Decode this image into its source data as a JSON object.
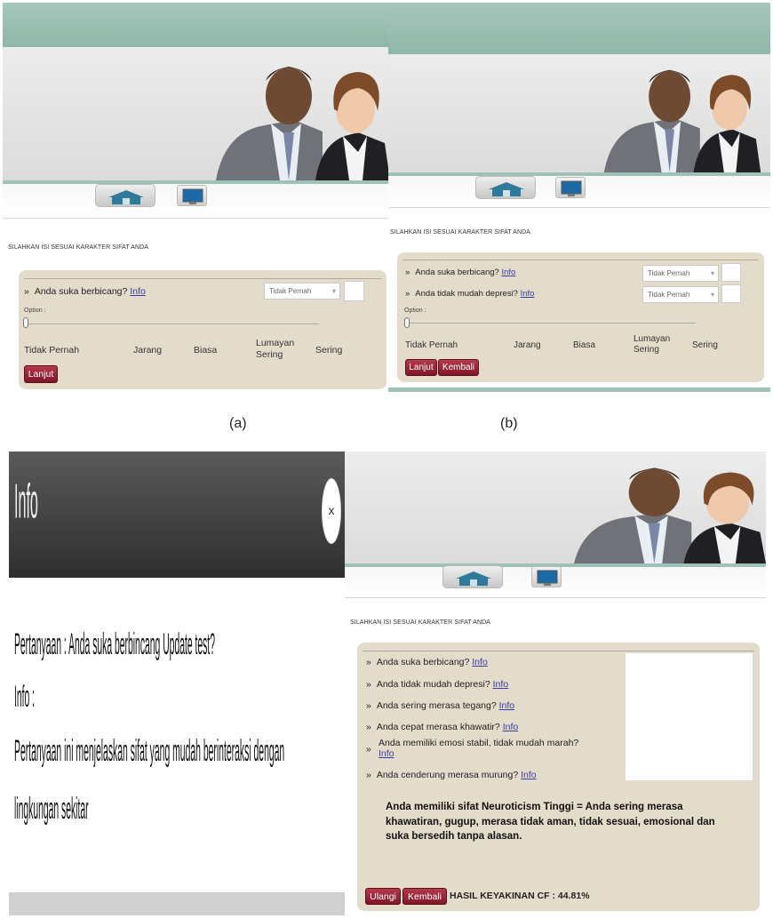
{
  "intro_text": "SILAHKAN ISI SESUAI KARAKTER SIFAT ANDA",
  "captions": {
    "a": "(a)",
    "b": "(b)"
  },
  "option_label": "Option :",
  "scale_labels": [
    "Tidak Pernah",
    "Jarang",
    "Biasa",
    "Lumayan Sering",
    "Sering"
  ],
  "info_link": "Info",
  "select_value": "Tidak Pernah",
  "buttons": {
    "lanjut": "Lanjut",
    "kembali": "Kembali",
    "ulangi": "Ulangi"
  },
  "questions": [
    "Anda suka berbicang?",
    "Anda tidak mudah depresi?",
    "Anda sering merasa tegang?",
    "Anda cepat merasa khawatir?",
    "Anda memiliki emosi stabil, tidak mudah marah?",
    "Anda cenderung merasa murung?"
  ],
  "info_popup": {
    "title": "Info",
    "close": "x",
    "question_line": "Pertanyaan : Anda suka berbincang Update test?",
    "info_label": "Info :",
    "explanation_1": "Pertanyaan ini menjelaskan sifat yang mudah berinteraksi dengan",
    "explanation_2": "lingkungan sekitar"
  },
  "result_text": "Anda memiliki sifat Neuroticism Tinggi = Anda sering merasa khawatiran, gugup, merasa tidak aman, tidak sesuai, emosional dan suka bersedih tanpa alasan.",
  "hasil_text": "HASIL KEYAKINAN CF : 44.81%"
}
